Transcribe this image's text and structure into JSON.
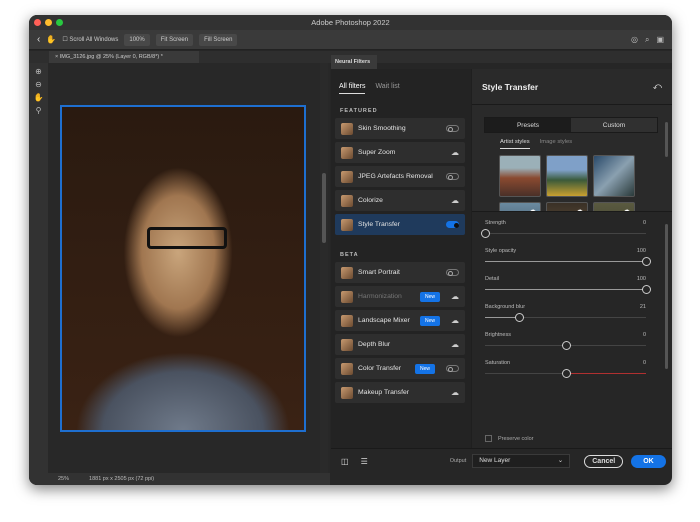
{
  "app": {
    "title": "Adobe Photoshop 2022"
  },
  "options": {
    "scroll_all": "Scroll All Windows",
    "zoom100": "100%",
    "fit": "Fit Screen",
    "fill": "Fill Screen"
  },
  "document": {
    "tab": "IMG_3126.jpg @ 25% (Layer 0, RGB/8*) *",
    "zoom": "25%",
    "size": "1881 px x 2505 px (72 ppi)"
  },
  "panel": {
    "title": "Neural Filters",
    "tabs": [
      "All filters",
      "Wait list"
    ],
    "featured_label": "FEATURED",
    "beta_label": "BETA",
    "featured": [
      {
        "label": "Skin Smoothing",
        "ctrl": "toggle"
      },
      {
        "label": "Super Zoom",
        "ctrl": "cloud"
      },
      {
        "label": "JPEG Artefacts Removal",
        "ctrl": "toggle"
      },
      {
        "label": "Colorize",
        "ctrl": "cloud"
      },
      {
        "label": "Style Transfer",
        "ctrl": "toggle-on"
      }
    ],
    "beta": [
      {
        "label": "Smart Portrait",
        "ctrl": "toggle"
      },
      {
        "label": "Harmonization",
        "ctrl": "cloud",
        "badge": "New"
      },
      {
        "label": "Landscape Mixer",
        "ctrl": "cloud",
        "badge": "New"
      },
      {
        "label": "Depth Blur",
        "ctrl": "cloud"
      },
      {
        "label": "Color Transfer",
        "ctrl": "toggle",
        "badge": "New"
      },
      {
        "label": "Makeup Transfer",
        "ctrl": "cloud"
      }
    ]
  },
  "style": {
    "title": "Style Transfer",
    "seg": [
      "Presets",
      "Custom"
    ],
    "subtabs": [
      "Artist styles",
      "Image styles"
    ],
    "sliders": [
      {
        "label": "Strength",
        "value": 0,
        "pct": 0
      },
      {
        "label": "Style opacity",
        "value": 100,
        "pct": 100
      },
      {
        "label": "Detail",
        "value": 100,
        "pct": 100
      },
      {
        "label": "Background blur",
        "value": 21,
        "pct": 21
      },
      {
        "label": "Brightness",
        "value": 0,
        "pct": 50
      },
      {
        "label": "Saturation",
        "value": 0,
        "pct": 50
      }
    ],
    "preserve": "Preserve color"
  },
  "footer": {
    "output_label": "Output",
    "output_value": "New Layer",
    "cancel": "Cancel",
    "ok": "OK"
  },
  "colors": {
    "accent": "#1473e6",
    "selected": "#1f3a5c"
  }
}
